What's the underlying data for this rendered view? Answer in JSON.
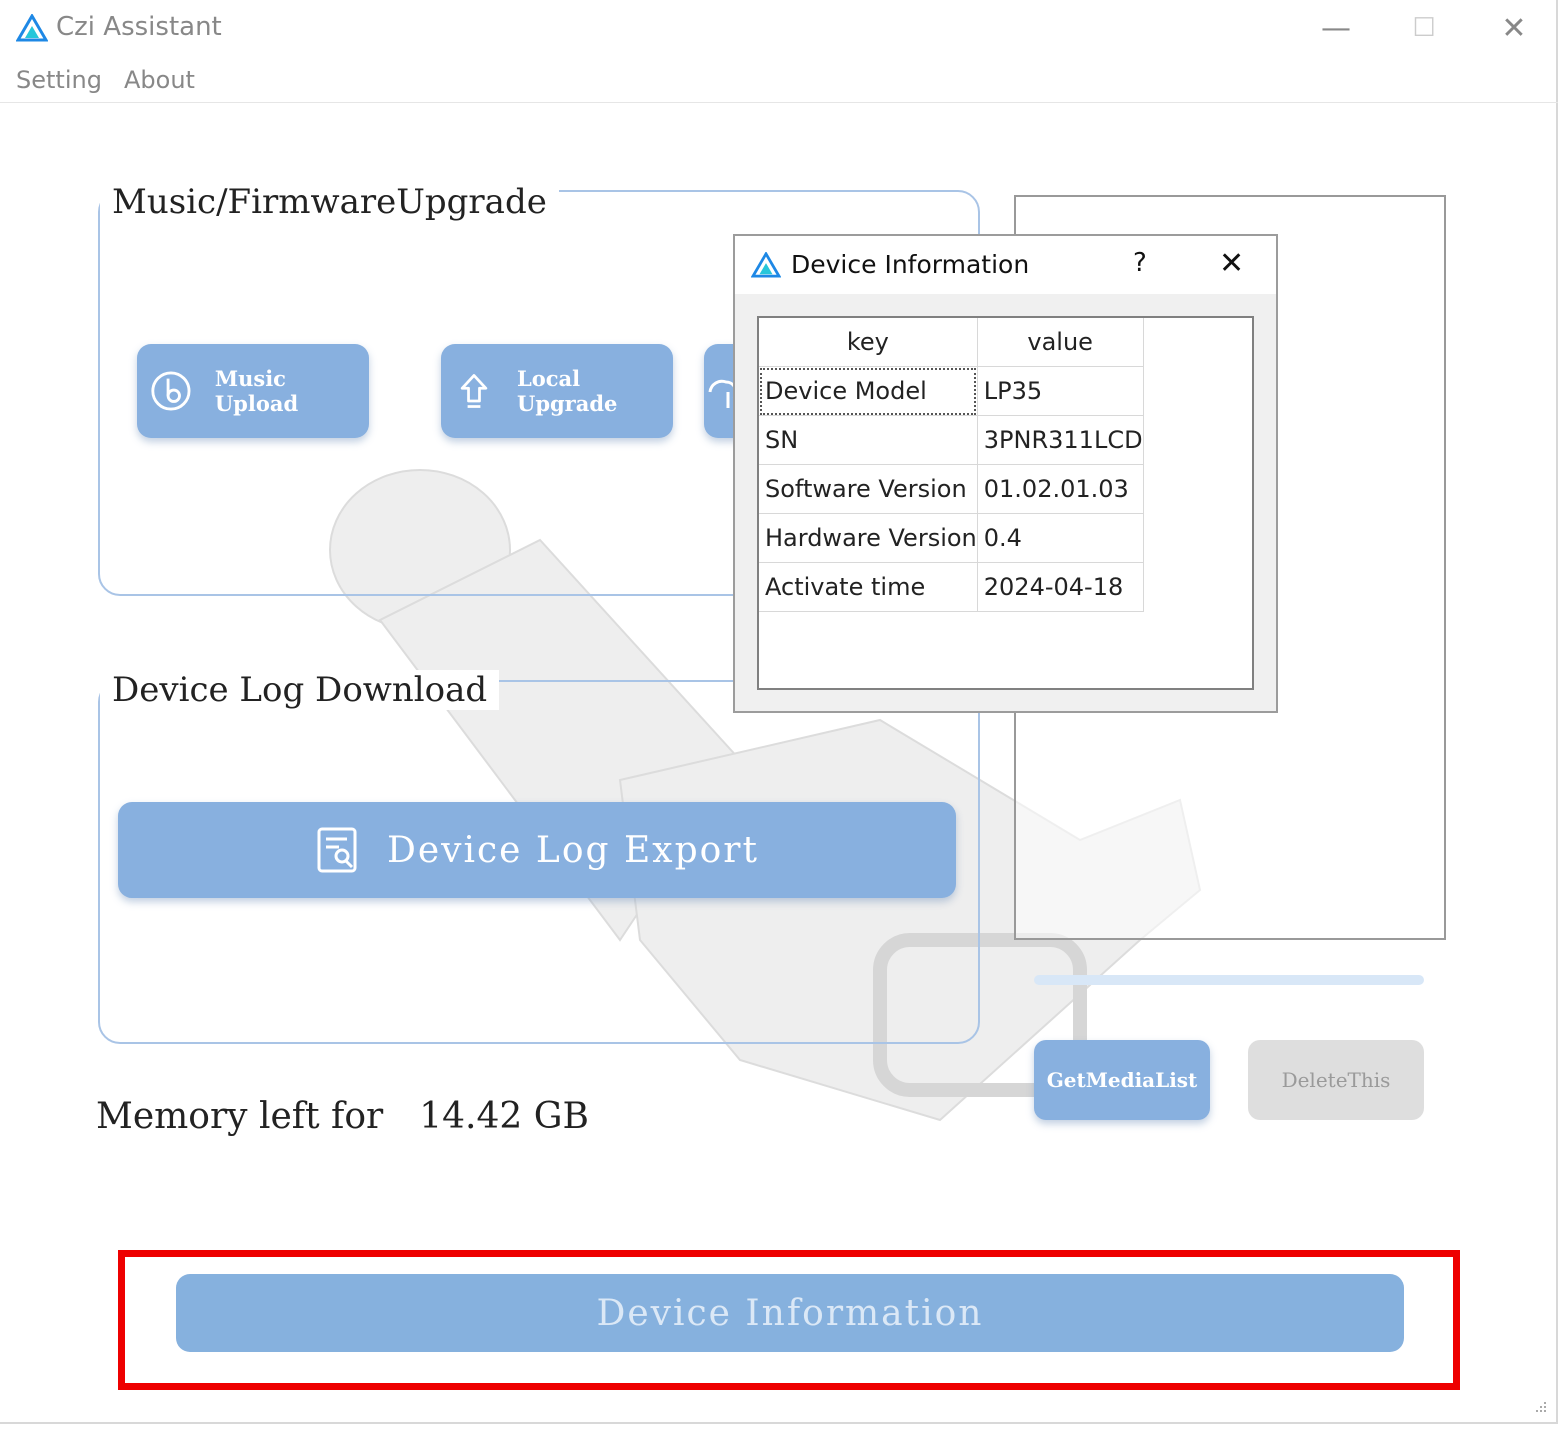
{
  "window": {
    "title": "Czi Assistant",
    "controls": {
      "minimize": "—",
      "maximize": "☐",
      "close": "✕"
    }
  },
  "menu": [
    "Setting",
    "About"
  ],
  "music_group": {
    "title": "Music/FirmwareUpgrade",
    "buttons": [
      "Music Upload",
      "Local Upgrade"
    ]
  },
  "log_group": {
    "title": "Device Log Download",
    "export_label": "Device Log Export"
  },
  "memory": {
    "label": "Memory left for",
    "value": "14.42 GB"
  },
  "media": {
    "get_label": "GetMediaList",
    "delete_label": "DeleteThis"
  },
  "device_info_button": "Device Information",
  "dialog": {
    "title": "Device Information",
    "help": "?",
    "close": "✕",
    "columns": [
      "key",
      "value"
    ],
    "rows": [
      {
        "key": "Device Model",
        "value": "LP35"
      },
      {
        "key": "SN",
        "value": "3PNR311LCD"
      },
      {
        "key": "Software Version",
        "value": "01.02.01.03"
      },
      {
        "key": "Hardware Version",
        "value": "0.4"
      },
      {
        "key": "Activate time",
        "value": "2024-04-18"
      }
    ]
  },
  "colors": {
    "accent_button": "#88b0df",
    "group_border": "#a9c4e6",
    "highlight": "#ee0000",
    "logo_blue": "#1e88e5",
    "logo_teal": "#26c6da"
  }
}
